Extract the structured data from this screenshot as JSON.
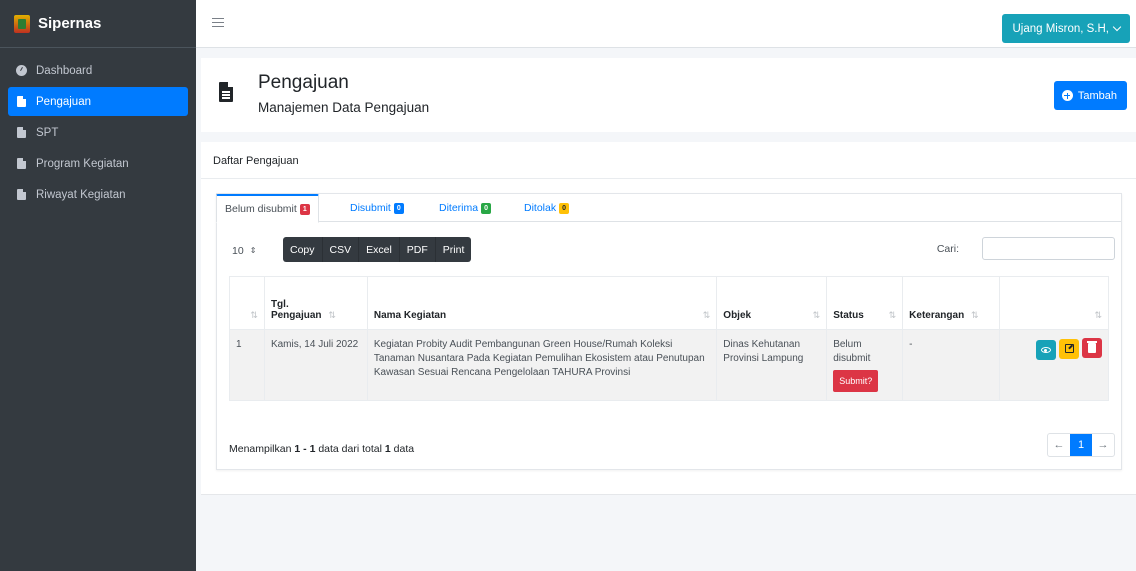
{
  "app": {
    "brand": "Sipernas"
  },
  "sidebar": {
    "items": [
      {
        "label": "Dashboard",
        "icon": "dashboard-icon",
        "active": false
      },
      {
        "label": "Pengajuan",
        "icon": "document-icon",
        "active": true
      },
      {
        "label": "SPT",
        "icon": "document-icon",
        "active": false
      },
      {
        "label": "Program Kegiatan",
        "icon": "document-icon",
        "active": false
      },
      {
        "label": "Riwayat Kegiatan",
        "icon": "document-icon",
        "active": false
      }
    ]
  },
  "topbar": {
    "user": "Ujang Misron, S.H,"
  },
  "header": {
    "title": "Pengajuan",
    "subtitle": "Manajemen Data Pengajuan",
    "add_label": "Tambah"
  },
  "card": {
    "title": "Daftar Pengajuan",
    "tabs": [
      {
        "label": "Belum disubmit",
        "badge": "1",
        "color": "#dc3545"
      },
      {
        "label": "Disubmit",
        "badge": "0",
        "color": "#007bff"
      },
      {
        "label": "Diterima",
        "badge": "0",
        "color": "#28a745"
      },
      {
        "label": "Ditolak",
        "badge": "0",
        "color": "#ffc107"
      }
    ],
    "length": "10",
    "export_buttons": [
      "Copy",
      "CSV",
      "Excel",
      "PDF",
      "Print"
    ],
    "search_label": "Cari:",
    "search_value": ""
  },
  "table": {
    "headers": {
      "tgl_line1": "Tgl.",
      "tgl_line2": "Pengajuan",
      "nama": "Nama Kegiatan",
      "objek": "Objek",
      "status": "Status",
      "keterangan": "Keterangan"
    },
    "rows": [
      {
        "no": "1",
        "tgl": "Kamis, 14 Juli 2022",
        "nama": "Kegiatan Probity Audit Pembangunan Green House/Rumah Koleksi Tanaman Nusantara Pada Kegiatan Pemulihan Ekosistem atau Penutupan Kawasan Sesuai Rencana Pengelolaan TAHURA Provinsi",
        "objek": "Dinas Kehutanan Provinsi Lampung",
        "status": "Belum disubmit",
        "submit_label": "Submit?",
        "keterangan": "-"
      }
    ]
  },
  "footer": {
    "info_prefix": "Menampilkan",
    "info_from": "1",
    "info_sep": "-",
    "info_to": "1",
    "info_mid": "data dari total",
    "info_total": "1",
    "info_suffix": "data",
    "current_page": "1",
    "prev": "←",
    "next": "→"
  }
}
